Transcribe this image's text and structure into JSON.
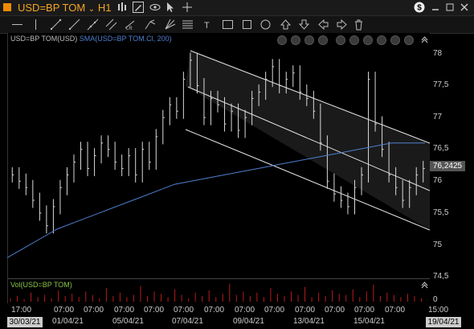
{
  "header": {
    "symbol": "USD=BP TOM",
    "timeframe": "H1"
  },
  "chart_legend": {
    "symbol_label": "USD=BP TOM(USD)",
    "sma_label": "SMA(USD=BP TOM.Cl, 200)"
  },
  "volume_legend": "Vol(USD=BP TOM)",
  "price_axis": [
    "78",
    "77,5",
    "77",
    "76,5",
    "76",
    "75,5",
    "75",
    "74,5"
  ],
  "current_price": "76,2425",
  "time_axis": {
    "times": [
      "17:00",
      "07:00",
      "07:00",
      "07:00",
      "07:00",
      "07:00",
      "07:00",
      "07:00",
      "07:00",
      "07:00",
      "07:00",
      "07:00",
      "07:00",
      "07:00",
      "15:00"
    ],
    "dates": [
      "01/04/21",
      "05/04/21",
      "07/04/21",
      "09/04/21",
      "13/04/21",
      "15/04/21"
    ],
    "start_date": "30/03/21",
    "end_date": "19/04/21"
  },
  "colors": {
    "sma": "#4f7fd0",
    "candles": "#d9d9d9",
    "volume": "#b71c1c",
    "channel": "#e6e6e6",
    "title": "#f5a623"
  },
  "chart_data": {
    "type": "line",
    "series": [
      {
        "name": "USD=BP TOM(USD)",
        "kind": "bars",
        "values": [
          76.1,
          76.0,
          75.9,
          75.7,
          75.5,
          75.3,
          75.6,
          75.9,
          76.1,
          76.3,
          76.5,
          76.2,
          76.4,
          76.6,
          76.5,
          76.3,
          76.2,
          76.4,
          76.1,
          76.5,
          76.3,
          76.7,
          77.0,
          77.2,
          77.1,
          77.6,
          77.9,
          77.5,
          77.0,
          77.3,
          77.2,
          76.9,
          77.1,
          76.8,
          77.0,
          77.3,
          77.4,
          77.6,
          77.8,
          77.5,
          77.6,
          77.7,
          77.4,
          77.3,
          77.1,
          76.6,
          76.0,
          75.8,
          75.7,
          75.6,
          75.9,
          76.1,
          77.6,
          76.9,
          76.5,
          76.1,
          75.9,
          75.7,
          75.9,
          76.1,
          76.2
        ]
      },
      {
        "name": "SMA(USD=BP TOM.Cl, 200)",
        "kind": "line",
        "values": [
          74.8,
          74.95,
          75.1,
          75.25,
          75.35,
          75.45,
          75.55,
          75.65,
          75.75,
          75.85,
          75.95,
          76.0,
          76.05,
          76.1,
          76.15,
          76.2,
          76.25,
          76.3,
          76.35,
          76.4,
          76.45,
          76.5,
          76.55,
          76.6,
          76.6,
          76.6
        ]
      }
    ],
    "ylim": [
      74.4,
      78.2
    ]
  }
}
